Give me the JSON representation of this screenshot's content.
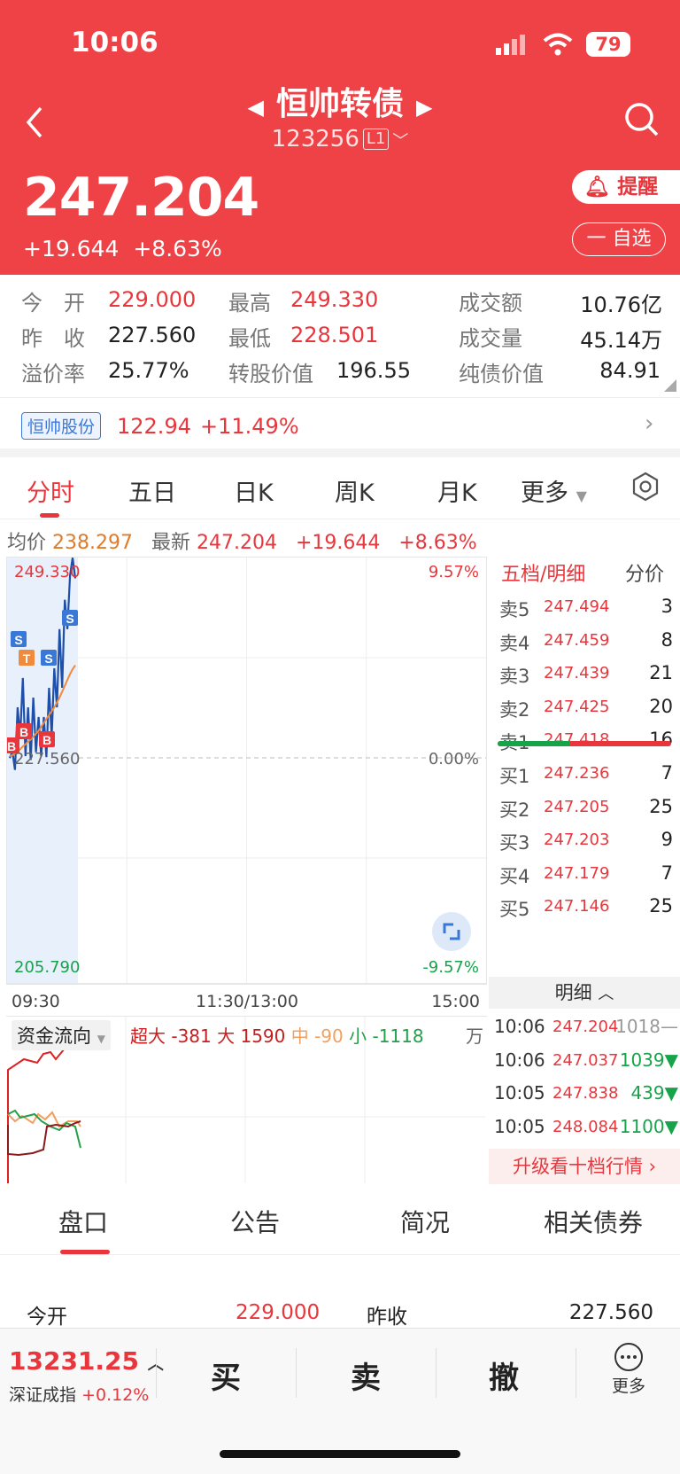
{
  "status": {
    "time": "10:06",
    "battery": "79"
  },
  "header": {
    "title": "恒帅转债",
    "code": "123256",
    "level": "L1",
    "price": "247.204",
    "change": "+19.644",
    "change_pct": "+8.63%",
    "alert_label": "提醒",
    "watch_label": "一 自选"
  },
  "stats": {
    "open_label": "今　开",
    "open": "229.000",
    "high_label": "最高",
    "high": "249.330",
    "amount_label": "成交额",
    "amount": "10.76亿",
    "prev_label": "昨　收",
    "prev": "227.560",
    "low_label": "最低",
    "low": "228.501",
    "volume_label": "成交量",
    "volume": "45.14万",
    "premium_label": "溢价率",
    "premium": "25.77%",
    "conv_label": "转股价值",
    "conv": "196.55",
    "bond_label": "纯债价值",
    "bond": "84.91"
  },
  "related_stock": {
    "name": "恒帅股份",
    "price": "122.94",
    "pct": "+11.49%"
  },
  "tabs": [
    "分时",
    "五日",
    "日K",
    "周K",
    "月K",
    "更多"
  ],
  "avgline": {
    "avg_label": "均价",
    "avg": "238.297",
    "latest_label": "最新",
    "latest": "247.204",
    "chg": "+19.644",
    "pct": "+8.63%"
  },
  "chart_data": {
    "type": "line",
    "y_top": "249.330",
    "y_mid": "227.560",
    "y_bot": "205.790",
    "pct_top": "9.57%",
    "pct_mid": "0.00%",
    "pct_bot": "-9.57%",
    "ylim": [
      205.79,
      249.33
    ],
    "x_labels": [
      "09:30",
      "11:30/13:00",
      "15:00"
    ],
    "series": [
      {
        "values": [
          228.8,
          229.5,
          227.6,
          234,
          231,
          237,
          229,
          234,
          228.6,
          235,
          229.4,
          233,
          229,
          233,
          228.9,
          236,
          231,
          238,
          234,
          242,
          236,
          245,
          242,
          247.5,
          249.3,
          247.2
        ]
      },
      {
        "values": [
          229,
          229.1,
          229.3,
          229.5,
          229.7,
          230,
          230.2,
          230.5,
          230.7,
          231,
          231.3,
          231.6,
          232,
          232.4,
          232.8,
          233.2,
          233.6,
          234,
          234.5,
          235,
          235.6,
          236.2,
          236.8,
          237.4,
          237.9,
          238.3
        ]
      }
    ],
    "markers": [
      "S",
      "T",
      "S",
      "S",
      "B",
      "B",
      "B"
    ]
  },
  "flow": {
    "tag": "资金流向",
    "legend": [
      {
        "label": "超大",
        "value": "-381"
      },
      {
        "label": "大",
        "value": "1590"
      },
      {
        "label": "中",
        "value": "-90"
      },
      {
        "label": "小",
        "value": "-1118"
      }
    ],
    "unit": "万"
  },
  "orderbook": {
    "title": "五档/明细",
    "toggle": "分价",
    "asks": [
      {
        "l": "卖5",
        "p": "247.494",
        "v": "3"
      },
      {
        "l": "卖4",
        "p": "247.459",
        "v": "8"
      },
      {
        "l": "卖3",
        "p": "247.439",
        "v": "21"
      },
      {
        "l": "卖2",
        "p": "247.425",
        "v": "20"
      },
      {
        "l": "卖1",
        "p": "247.418",
        "v": "16"
      }
    ],
    "bids": [
      {
        "l": "买1",
        "p": "247.236",
        "v": "7"
      },
      {
        "l": "买2",
        "p": "247.205",
        "v": "25"
      },
      {
        "l": "买3",
        "p": "247.203",
        "v": "9"
      },
      {
        "l": "买4",
        "p": "247.179",
        "v": "7"
      },
      {
        "l": "买5",
        "p": "247.146",
        "v": "25"
      }
    ],
    "ratio_buy": 0.42,
    "detail_label": "明细",
    "details": [
      {
        "t": "10:06",
        "p": "247.204",
        "v": "1018",
        "d": "—",
        "c": "#999999"
      },
      {
        "t": "10:06",
        "p": "247.037",
        "v": "1039",
        "d": "▼",
        "c": "#17a34a"
      },
      {
        "t": "10:05",
        "p": "247.838",
        "v": "439",
        "d": "▼",
        "c": "#17a34a"
      },
      {
        "t": "10:05",
        "p": "248.084",
        "v": "1100",
        "d": "▼",
        "c": "#17a34a"
      }
    ],
    "upgrade": "升级看十档行情 ›"
  },
  "bottom_tabs": [
    "盘口",
    "公告",
    "简况",
    "相关债券"
  ],
  "open_row": {
    "open_label": "今开",
    "open": "229.000",
    "prev_label": "昨收",
    "prev": "227.560"
  },
  "footer": {
    "index_value": "13231.25",
    "index_name": "深证成指",
    "index_pct": "+0.12%",
    "buy": "买",
    "sell": "卖",
    "cancel": "撤",
    "more": "更多"
  }
}
